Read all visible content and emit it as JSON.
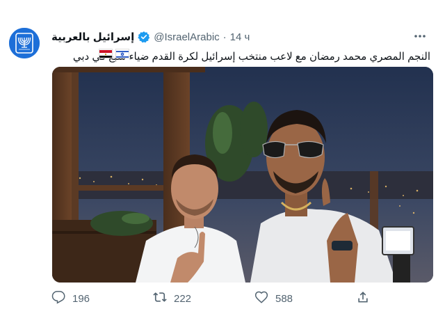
{
  "account": {
    "display_name": "إسرائيل بالعربية",
    "handle": "@IsraelArabic",
    "separator": "·",
    "time": "14 ч",
    "more_icon": "more-dots-icon",
    "verified_icon": "verified-badge-icon",
    "avatar_icon": "menorah-emblem-icon"
  },
  "tweet": {
    "text": "النجم المصري محمد رمضان مع لاعب منتخب إسرائيل لكرة القدم ضياء سبع في دبي",
    "flags": [
      "egypt-flag-icon",
      "israel-flag-icon"
    ]
  },
  "media": {
    "icon": "photo-two-men-rooftop"
  },
  "actions": {
    "reply_count": "196",
    "retweet_count": "222",
    "like_count": "588",
    "reply_icon": "reply-icon",
    "retweet_icon": "retweet-icon",
    "like_icon": "heart-icon",
    "share_icon": "share-icon"
  },
  "colors": {
    "accent": "#1d9bf0",
    "avatar_bg": "#1d6fd8",
    "muted": "#536471"
  }
}
